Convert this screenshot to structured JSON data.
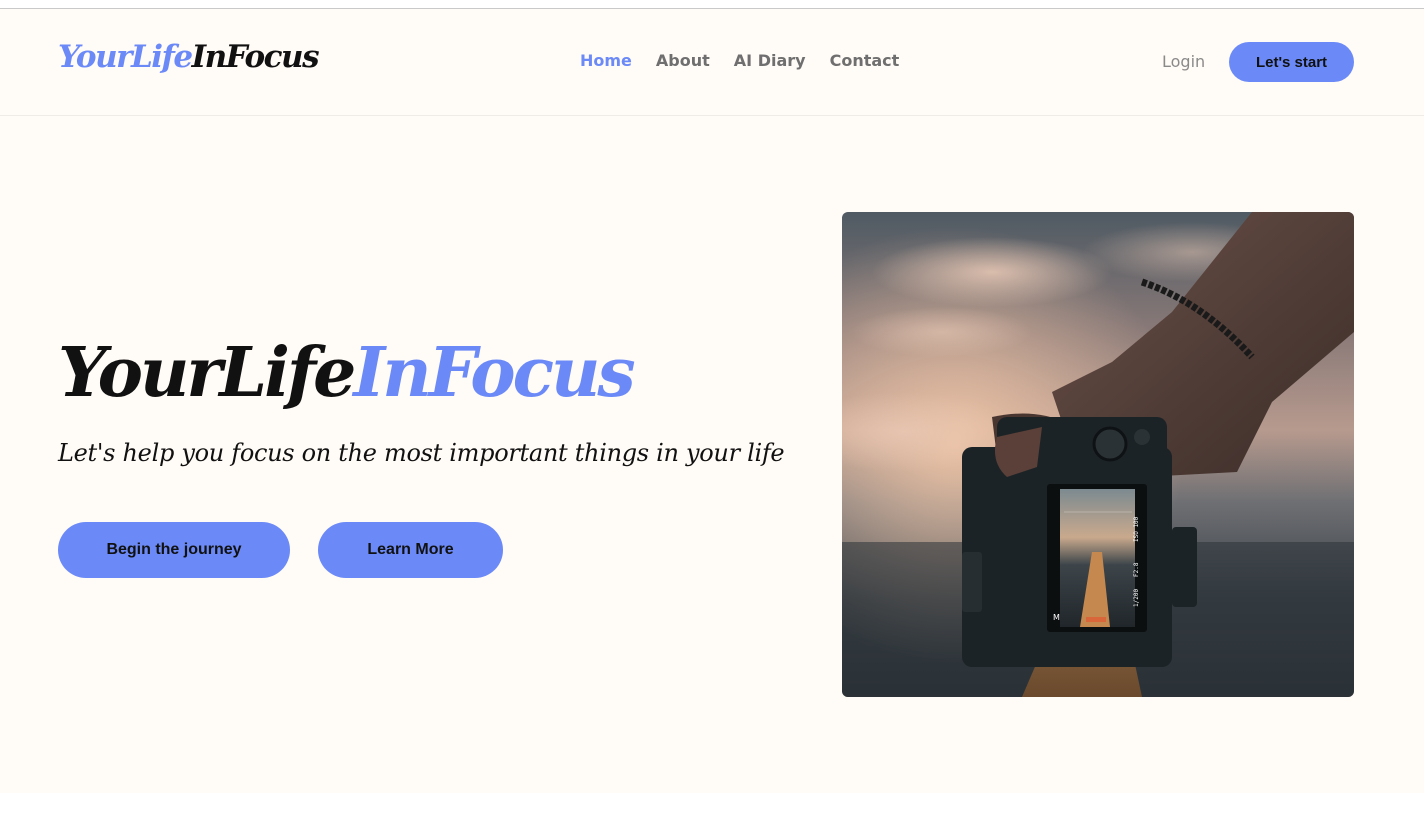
{
  "brand": {
    "logo_part1": "YourLife",
    "logo_part2": "InFocus"
  },
  "nav": {
    "items": [
      {
        "label": "Home",
        "active": true
      },
      {
        "label": "About",
        "active": false
      },
      {
        "label": "AI Diary",
        "active": false
      },
      {
        "label": "Contact",
        "active": false
      }
    ]
  },
  "header": {
    "login_label": "Login",
    "start_label": "Let's start"
  },
  "hero": {
    "title_part1": "YourLife",
    "title_part2": "InFocus",
    "subtitle": "Let's help you focus on the most important things in your life",
    "primary_button": "Begin the journey",
    "secondary_button": "Learn More",
    "camera_screen": {
      "mode": "M",
      "shutter": "1/200",
      "aperture": "F2.8",
      "iso": "ISO 100",
      "exposure_scale": "-3..2..1..0..1..2..3"
    }
  },
  "colors": {
    "accent": "#6b8af7",
    "background": "#fffbf6",
    "text": "#111111"
  }
}
